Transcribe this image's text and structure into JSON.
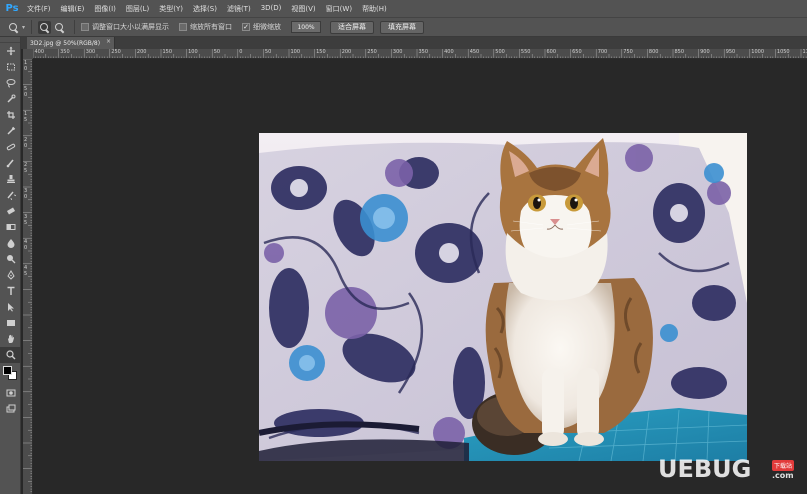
{
  "app": {
    "logo": "Ps"
  },
  "menu": [
    "文件(F)",
    "编辑(E)",
    "图像(I)",
    "图层(L)",
    "类型(Y)",
    "选择(S)",
    "滤镜(T)",
    "3D(D)",
    "视图(V)",
    "窗口(W)",
    "帮助(H)"
  ],
  "options": {
    "tool_icon": "zoom-icon",
    "resize_windows_label": "调整窗口大小以满屏显示",
    "zoom_all_windows_label": "缩放所有窗口",
    "scrubby_zoom_label": "细微缩放",
    "scrubby_zoom_checked": true,
    "zoom_percent": "100%",
    "fit_screen_label": "适合屏幕",
    "fill_screen_label": "填充屏幕"
  },
  "tools": [
    "move-icon",
    "marquee-icon",
    "lasso-icon",
    "quick-select-icon",
    "crop-icon",
    "eyedropper-icon",
    "healing-brush-icon",
    "brush-icon",
    "clone-stamp-icon",
    "history-brush-icon",
    "eraser-icon",
    "gradient-icon",
    "blur-icon",
    "dodge-icon",
    "pen-icon",
    "type-icon",
    "path-select-icon",
    "rectangle-icon",
    "hand-icon",
    "zoom-icon"
  ],
  "document": {
    "tab_title": "3D2.jpg @ 50%(RGB/8)",
    "close": "×"
  },
  "ruler": {
    "h_labels": [
      "400",
      "350",
      "300",
      "250",
      "200",
      "150",
      "100",
      "50",
      "0",
      "50",
      "100",
      "150",
      "200",
      "250",
      "300",
      "350",
      "400",
      "450",
      "500",
      "550",
      "600",
      "650",
      "700",
      "750",
      "800",
      "850",
      "900",
      "950",
      "1000",
      "1050",
      "1100"
    ],
    "v_labels": [
      "1",
      "0",
      "5",
      "0",
      "1",
      "5",
      "2",
      "0",
      "2",
      "5",
      "3",
      "0",
      "3",
      "5",
      "4",
      "0",
      "4",
      "5"
    ]
  },
  "watermark": {
    "main": "UEBUG",
    "dotcom": ".com",
    "sub": "下载站"
  }
}
